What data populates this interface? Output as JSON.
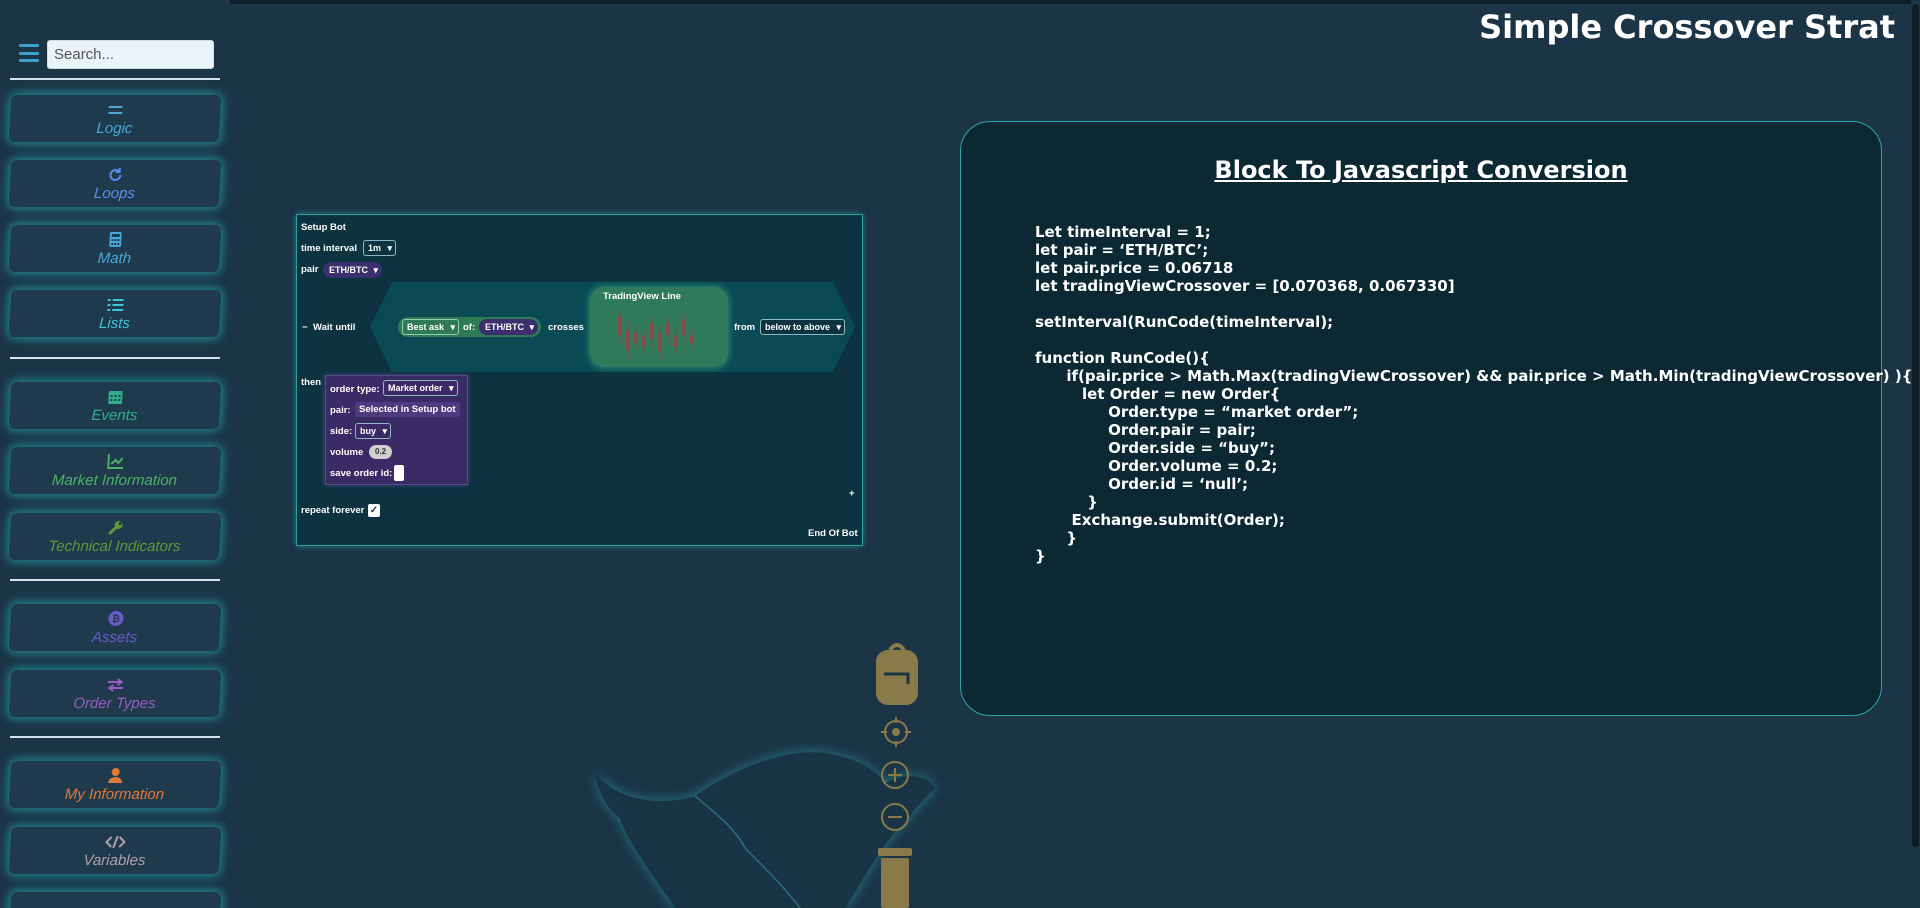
{
  "header": {
    "title": "Simple Crossover Strat"
  },
  "search": {
    "placeholder": "Search..."
  },
  "sidebar": {
    "items": [
      {
        "label": "Logic",
        "icon": "equals-icon",
        "color": "#4aa8d8"
      },
      {
        "label": "Loops",
        "icon": "refresh-icon",
        "color": "#5b8ef0"
      },
      {
        "label": "Math",
        "icon": "calculator-icon",
        "color": "#4aa8d8"
      },
      {
        "label": "Lists",
        "icon": "list-icon",
        "color": "#3fc6d8"
      },
      {
        "label": "Events",
        "icon": "calendar-icon",
        "color": "#2fae8a"
      },
      {
        "label": "Market Information",
        "icon": "chart-line-icon",
        "color": "#4fb06a"
      },
      {
        "label": "Technical Indicators",
        "icon": "wrench-icon",
        "color": "#5e9a3a"
      },
      {
        "label": "Assets",
        "icon": "bitcoin-icon",
        "color": "#6a5acd"
      },
      {
        "label": "Order Types",
        "icon": "exchange-icon",
        "color": "#9a5cc0"
      },
      {
        "label": "My Information",
        "icon": "user-icon",
        "color": "#e07a3a"
      },
      {
        "label": "Variables",
        "icon": "code-icon",
        "color": "#b0a0a8"
      }
    ]
  },
  "blocks": {
    "setup_bot": "Setup Bot",
    "time_interval_label": "time interval",
    "time_interval_value": "1m",
    "pair_label": "pair",
    "pair_value": "ETH/BTC",
    "minus": "−",
    "wait_until": "Wait until",
    "best_ask": "Best ask",
    "of_label": "of:",
    "of_value": "ETH/BTC",
    "crosses": "crosses",
    "tradingview_line": "TradingView Line",
    "from_label": "from",
    "direction_value": "below to above",
    "then_label": "then",
    "order_type_label": "order type:",
    "order_type_value": "Market order",
    "order_pair_label": "pair:",
    "order_pair_value": "Selected in Setup bot",
    "side_label": "side:",
    "side_value": "buy",
    "volume_label": "volume",
    "volume_value": "0.2",
    "save_order_id_label": "save order id:",
    "repeat_forever": "repeat forever",
    "repeat_checked": "✓",
    "plus": "+",
    "end_of_bot": "End Of Bot"
  },
  "code_panel": {
    "title": "Block To Javascript Conversion",
    "lines": [
      "Let timeInterval = 1;",
      "let pair = ‘ETH/BTC’;",
      "let pair.price = 0.06718",
      "let tradingViewCrossover = [0.070368, 0.067330]",
      "",
      "setInterval(RunCode(timeInterval);",
      "",
      "function RunCode(){",
      "      if(pair.price > Math.Max(tradingViewCrossover) && pair.price > Math.Min(tradingViewCrossover) ){",
      "         let Order = new Order{",
      "              Order.type = “market order”;",
      "              Order.pair = pair;",
      "              Order.side = “buy”;",
      "              Order.volume = 0.2;",
      "              Order.id = ‘null’;",
      "          }",
      "       Exchange.submit(Order);",
      "      }",
      "}"
    ]
  },
  "colors": {
    "background": "#1b3446",
    "accent_glow": "#28d2d2",
    "workspace_tool": "#8a7a4a"
  }
}
